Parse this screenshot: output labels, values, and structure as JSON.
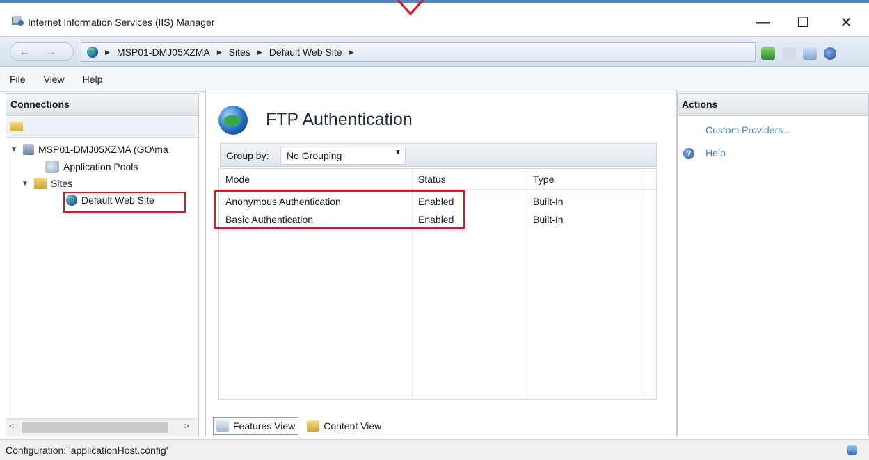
{
  "window": {
    "title": "Internet Information Services (IIS) Manager",
    "minimize": "—",
    "maximize": "☐",
    "close": "✕"
  },
  "address": {
    "back": "←",
    "forward": "→",
    "crumbs": [
      "MSP01-DMJ05XZMA",
      "Sites",
      "Default Web Site"
    ],
    "separator": "▶"
  },
  "menu": [
    "File",
    "View",
    "Help"
  ],
  "connections": {
    "header": "Connections",
    "tree": {
      "server": "MSP01-DMJ05XZMA (GO\\ma",
      "app_pools": "Application Pools",
      "sites": "Sites",
      "site": "Default Web Site"
    },
    "scroll_left": "<",
    "scroll_right": ">"
  },
  "feature": {
    "title": "FTP Authentication",
    "group_by_label": "Group by:",
    "group_by_value": "No Grouping",
    "columns": [
      "Mode",
      "Status",
      "Type"
    ],
    "rows": [
      {
        "mode": "Anonymous Authentication",
        "status": "Enabled",
        "type": "Built-In"
      },
      {
        "mode": "Basic Authentication",
        "status": "Enabled",
        "type": "Built-In"
      }
    ],
    "tabs": {
      "features": "Features View",
      "content": "Content View"
    }
  },
  "actions": {
    "header": "Actions",
    "custom_providers": "Custom Providers...",
    "help": "Help"
  },
  "status": {
    "text": "Configuration: 'applicationHost.config'"
  },
  "colors": {
    "annotation_red": "#e0141b",
    "link_blue": "#4a7fc4",
    "accent_blue": "#4a86c8"
  }
}
